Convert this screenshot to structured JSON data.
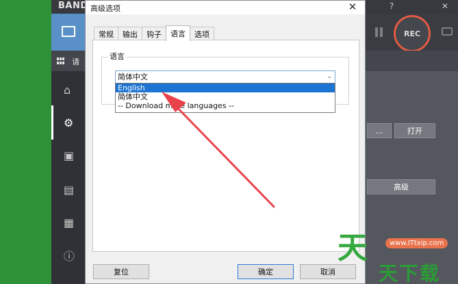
{
  "background_app": {
    "brand": "BAND",
    "rec_label": "REC",
    "menu_text": "请",
    "right_panel": {
      "browse_label": "...",
      "open_label": "打开",
      "advanced_label": "高级"
    }
  },
  "dialog": {
    "title": "高级选项",
    "close_glyph": "✕",
    "tabs": [
      {
        "label": "常规"
      },
      {
        "label": "输出"
      },
      {
        "label": "钩子"
      },
      {
        "label": "语言"
      },
      {
        "label": "选项"
      }
    ],
    "active_tab": "语言",
    "language_group": {
      "label": "语言",
      "selected_value": "简体中文",
      "options": [
        {
          "label": "English",
          "highlighted": true
        },
        {
          "label": "简体中文",
          "highlighted": false
        },
        {
          "label": "-- Download more languages --",
          "highlighted": false
        }
      ]
    },
    "buttons": {
      "reset": "复位",
      "ok": "确定",
      "cancel": "取消"
    }
  },
  "watermark": {
    "glyph": "天",
    "site": "www.ITtxip.com",
    "text": "天下载"
  },
  "colors": {
    "accent": "#e35b42",
    "selection": "#1e74d2",
    "arrow": "#e8434a",
    "left_strip": "#2e9137"
  }
}
